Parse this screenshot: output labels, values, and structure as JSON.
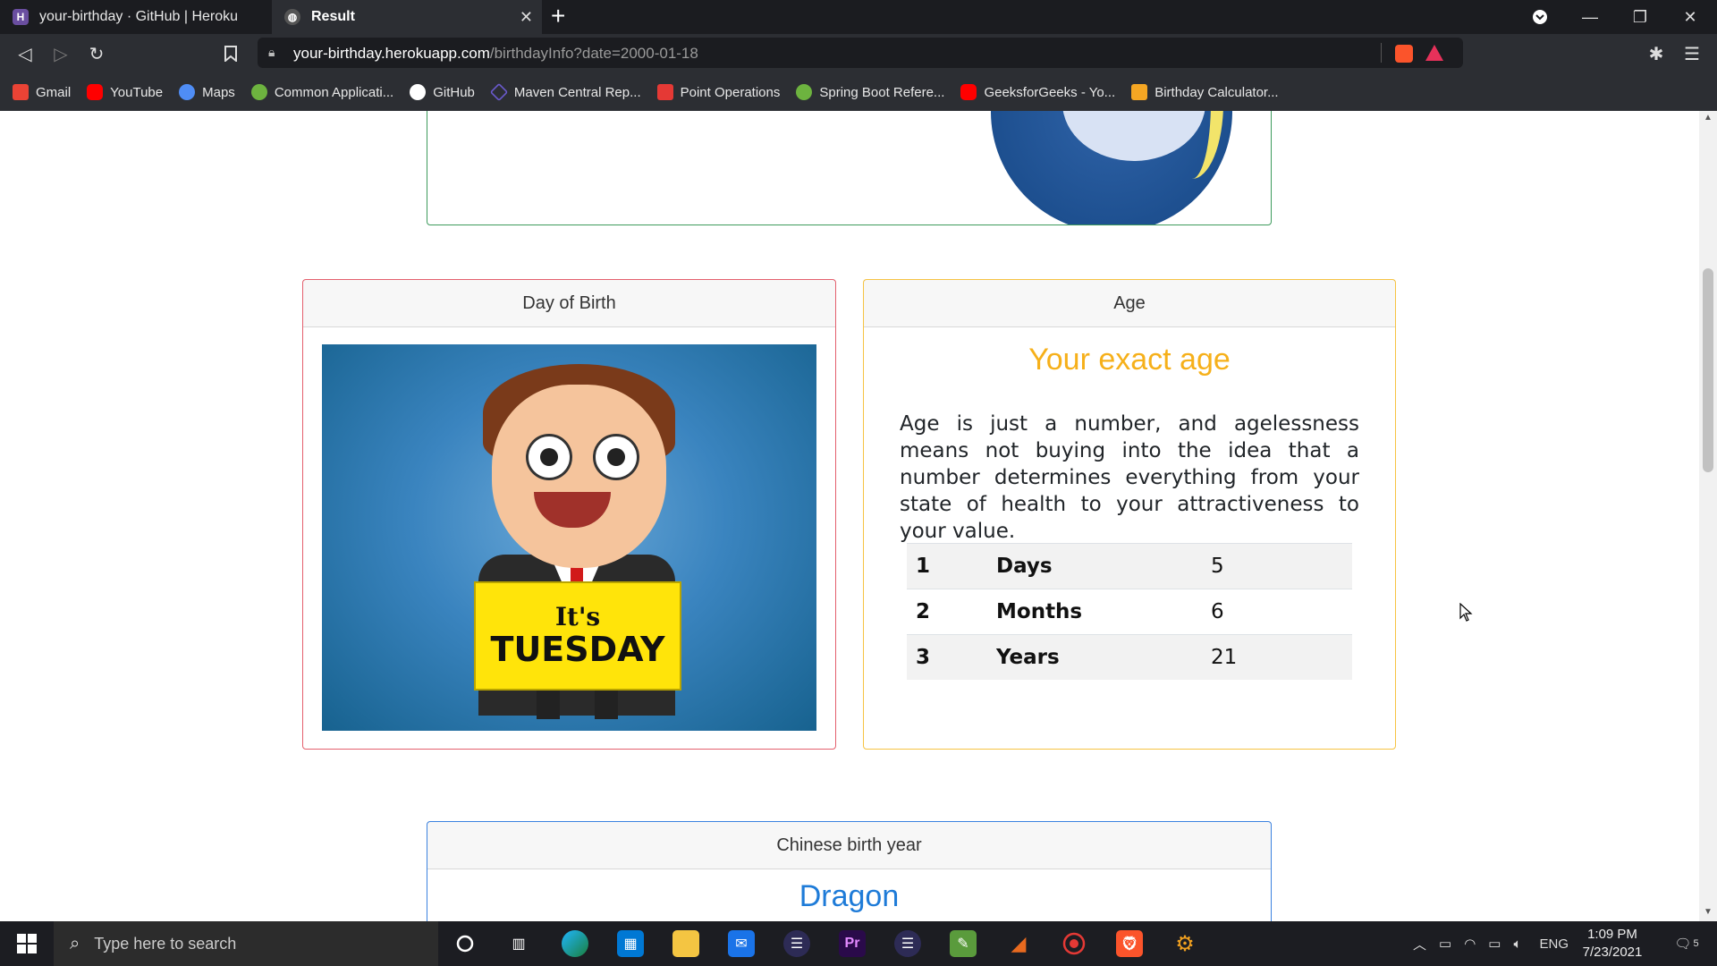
{
  "browser": {
    "tabs": [
      {
        "title": "your-birthday · GitHub | Heroku",
        "icon": "heroku-icon"
      },
      {
        "title": "Result",
        "icon": "globe-icon"
      }
    ],
    "url_domain": "your-birthday.herokuapp.com",
    "url_path": "/birthdayInfo?date=2000-01-18",
    "bookmarks": [
      {
        "label": "Gmail",
        "icon": "gmail-icon",
        "color": "#ea4335"
      },
      {
        "label": "YouTube",
        "icon": "youtube-icon",
        "color": "#ff0000"
      },
      {
        "label": "Maps",
        "icon": "maps-icon",
        "color": "#4f8df5"
      },
      {
        "label": "Common Applicati...",
        "icon": "leaf-icon",
        "color": "#6db33f"
      },
      {
        "label": "GitHub",
        "icon": "github-icon",
        "color": "#ffffff"
      },
      {
        "label": "Maven Central Rep...",
        "icon": "maven-icon",
        "color": "#6a5acd"
      },
      {
        "label": "Point Operations",
        "icon": "point-icon",
        "color": "#e53935"
      },
      {
        "label": "Spring Boot Refere...",
        "icon": "spring-icon",
        "color": "#6db33f"
      },
      {
        "label": "GeeksforGeeks - Yo...",
        "icon": "youtube-icon",
        "color": "#ff0000"
      },
      {
        "label": "Birthday Calculator...",
        "icon": "calendar-icon",
        "color": "#f5a623"
      }
    ]
  },
  "page": {
    "day_of_birth": {
      "header": "Day of Birth",
      "sign_line1": "It's",
      "sign_line2": "TUESDAY"
    },
    "age": {
      "header": "Age",
      "title": "Your exact age",
      "text": "Age is just a number, and agelessness means not buying into the idea that a number determines everything from your state of health to your attractiveness to your value.",
      "rows": [
        {
          "num": "1",
          "label": "Days",
          "value": "5"
        },
        {
          "num": "2",
          "label": "Months",
          "value": "6"
        },
        {
          "num": "3",
          "label": "Years",
          "value": "21"
        }
      ]
    },
    "chinese": {
      "header": "Chinese birth year",
      "animal": "Dragon"
    }
  },
  "taskbar": {
    "search_placeholder": "Type here to search",
    "lang": "ENG",
    "time": "1:09 PM",
    "date": "7/23/2021",
    "notifications": "5"
  },
  "colors": {
    "day_card_border": "#e4606d",
    "age_card_border": "#f6c343",
    "top_card_border": "#3d9a5c",
    "chinese_card_border": "#3b82e0",
    "age_title": "#f6b01a",
    "dragon": "#1e7bd8"
  }
}
